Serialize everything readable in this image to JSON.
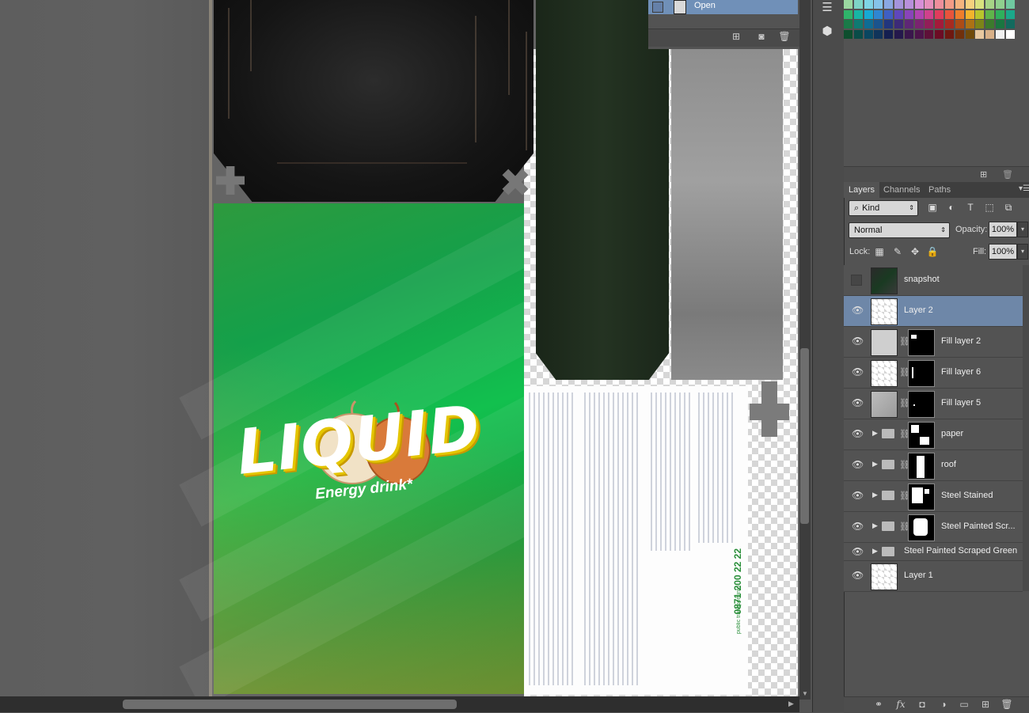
{
  "history": {
    "items": [
      {
        "label": "Open"
      }
    ],
    "footer_icons": [
      "new-document-icon",
      "camera-icon",
      "trash-icon"
    ]
  },
  "tools": {
    "icons": [
      "menu-lines-icon",
      "3d-cube-icon"
    ]
  },
  "swatches": {
    "colors": [
      "#9ad8a0",
      "#7ed4c6",
      "#7fd4e6",
      "#86c4ea",
      "#8aa8e2",
      "#a594dc",
      "#b990dc",
      "#d78fd8",
      "#e58fbc",
      "#ee8f9c",
      "#f29c86",
      "#f4b47e",
      "#f6d27e",
      "#d9e27e",
      "#a6d486",
      "#8fd08e",
      "#6fc9a0",
      "#2fb46a",
      "#17b5a4",
      "#17a9d4",
      "#2f86d2",
      "#3f5fc4",
      "#5f47bc",
      "#8944ba",
      "#b043b0",
      "#d0418c",
      "#e03c5c",
      "#e8543c",
      "#ee7e2c",
      "#f2b42c",
      "#b8c52c",
      "#5fb44a",
      "#2fb05c",
      "#1aa88a",
      "#1a7a48",
      "#0f7a72",
      "#0f6c94",
      "#1a548e",
      "#22367e",
      "#3c2a78",
      "#5e2776",
      "#7a2470",
      "#921e58",
      "#a41a3a",
      "#a82a20",
      "#ac4c16",
      "#ac7214",
      "#7c8418",
      "#3c7a2c",
      "#1a7640",
      "#126a5e",
      "#0e4e2e",
      "#0a4c48",
      "#0a4660",
      "#10345a",
      "#141f50",
      "#24184c",
      "#3a164c",
      "#4c144a",
      "#5e1038",
      "#6c0c24",
      "#6e1810",
      "#70300c",
      "#704a0a",
      "#e8c8a0",
      "#d8b088",
      "#f0f0f0",
      "#ffffff"
    ]
  },
  "layers_panel": {
    "tabs": [
      "Layers",
      "Channels",
      "Paths"
    ],
    "active_tab": "Layers",
    "filter": {
      "kind": "Kind",
      "icons": [
        "image-filter-icon",
        "adjustment-filter-icon",
        "type-filter-icon",
        "shape-filter-icon",
        "smart-object-filter-icon"
      ]
    },
    "blend_mode": "Normal",
    "opacity_label": "Opacity:",
    "opacity": "100%",
    "lock_label": "Lock:",
    "lock_icons": [
      "lock-transparency-icon",
      "lock-paint-icon",
      "lock-move-icon",
      "lock-all-icon"
    ],
    "fill_label": "Fill:",
    "fill": "100%",
    "layers": [
      {
        "name": "snapshot",
        "visible": false,
        "selected": false,
        "group": false,
        "mask": false
      },
      {
        "name": "Layer 2",
        "visible": true,
        "selected": true,
        "group": false,
        "mask": false
      },
      {
        "name": "Fill layer 2",
        "visible": true,
        "selected": false,
        "group": false,
        "mask": true
      },
      {
        "name": "Fill layer 6",
        "visible": true,
        "selected": false,
        "group": false,
        "mask": true
      },
      {
        "name": "Fill layer 5",
        "visible": true,
        "selected": false,
        "group": false,
        "mask": true
      },
      {
        "name": "paper",
        "visible": true,
        "selected": false,
        "group": true,
        "mask": true
      },
      {
        "name": "roof",
        "visible": true,
        "selected": false,
        "group": true,
        "mask": true
      },
      {
        "name": "Steel Stained",
        "visible": true,
        "selected": false,
        "group": true,
        "mask": true
      },
      {
        "name": "Steel Painted Scr...",
        "visible": true,
        "selected": false,
        "group": true,
        "mask": true
      },
      {
        "name": "Steel Painted Scraped Green",
        "visible": true,
        "selected": false,
        "group": true,
        "mask": false
      },
      {
        "name": "Layer 1",
        "visible": true,
        "selected": false,
        "group": false,
        "mask": false
      }
    ],
    "footer_icons": [
      "link-icon",
      "fx-icon",
      "add-mask-icon",
      "adjustment-layer-icon",
      "new-group-icon",
      "new-layer-icon",
      "trash-icon"
    ]
  },
  "canvas": {
    "label_logo": "LIQUID",
    "label_subtitle": "Energy drink*",
    "phone_number": "0871 200 22 22",
    "phone_note": "public transport info"
  }
}
